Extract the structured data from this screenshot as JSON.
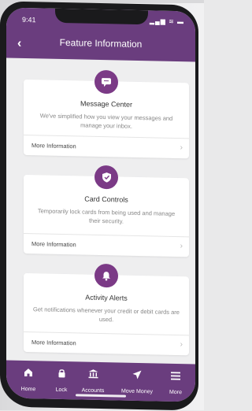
{
  "status": {
    "time": "9:41",
    "icons": "▂▄▆ ≋ ▬"
  },
  "header": {
    "title": "Feature Information",
    "back_icon": "back-chevron-icon"
  },
  "cards": [
    {
      "title": "Message Center",
      "description": "We've simplified how you view your messages and manage your inbox.",
      "more": "More Information",
      "icon": "chat-bubble-icon"
    },
    {
      "title": "Card Controls",
      "description": "Temporarily lock cards from being used and manage their security.",
      "more": "More Information",
      "icon": "shield-check-icon"
    },
    {
      "title": "Activity Alerts",
      "description": "Get notifications whenever your credit or debit cards are used.",
      "more": "More Information",
      "icon": "bell-icon"
    }
  ],
  "tabs": [
    {
      "label": "Home",
      "icon": "home-icon"
    },
    {
      "label": "Lock",
      "icon": "lock-icon"
    },
    {
      "label": "Accounts",
      "icon": "bank-icon"
    },
    {
      "label": "Move Money",
      "icon": "send-arrow-icon"
    },
    {
      "label": "More",
      "icon": "menu-icon"
    }
  ],
  "colors": {
    "brand": "#6a3d7e",
    "badge": "#7b3a86",
    "background": "#eeeeef"
  }
}
